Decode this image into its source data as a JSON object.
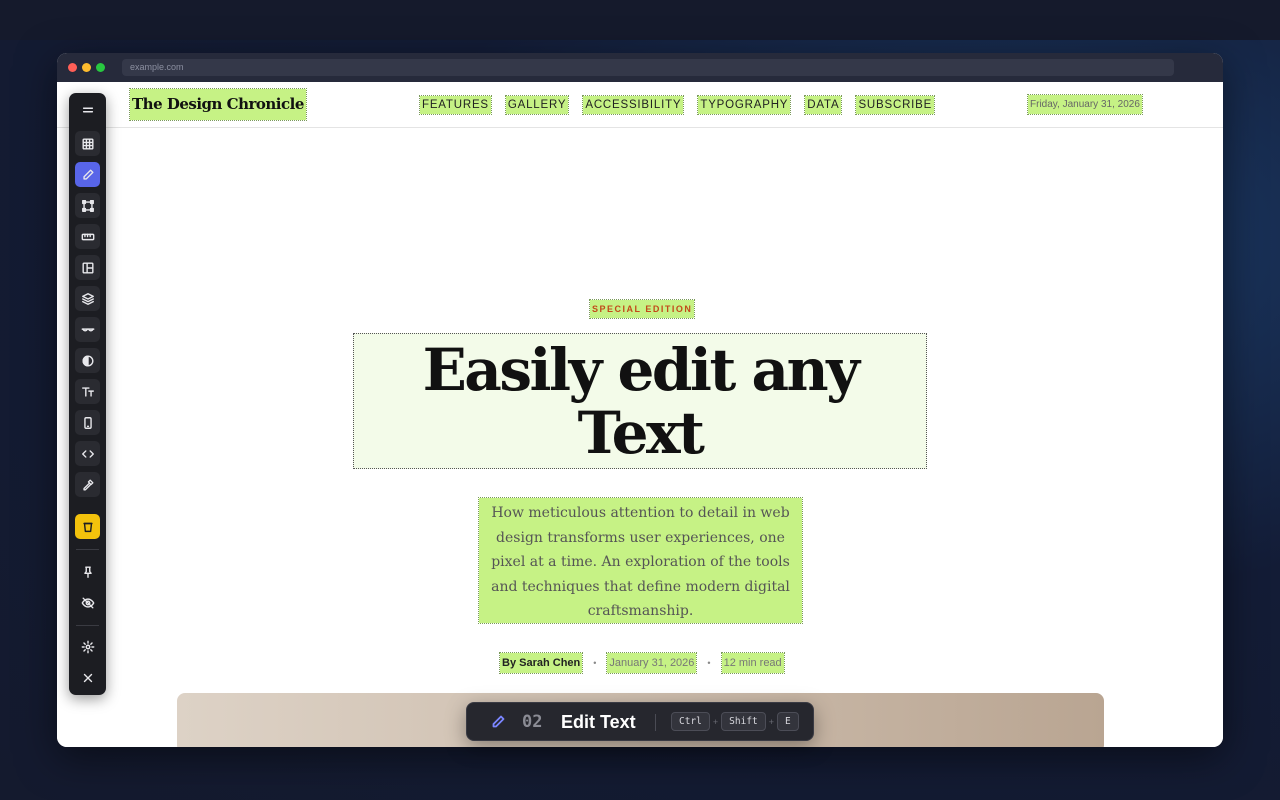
{
  "browser": {
    "url": "example.com"
  },
  "site": {
    "brand": "The Design Chronicle",
    "nav": [
      "FEATURES",
      "GALLERY",
      "ACCESSIBILITY",
      "TYPOGRAPHY",
      "DATA",
      "SUBSCRIBE"
    ],
    "date": "Friday, January 31, 2026"
  },
  "article": {
    "kicker": "SPECIAL EDITION",
    "headline_line1": "Easily edit any",
    "headline_line2": "Text",
    "lede": "How meticulous attention to detail in web design transforms user experiences, one pixel at a time. An exploration of the tools and techniques that define modern digital craftsmanship.",
    "author": "By Sarah Chen",
    "separator": "•",
    "date": "January 31, 2026",
    "read_time": "12 min read"
  },
  "toolbar": {
    "tools": [
      {
        "name": "menu",
        "icon": "menu-icon"
      },
      {
        "name": "grid",
        "icon": "grid-icon"
      },
      {
        "name": "edit-text",
        "icon": "pencil-icon",
        "active": true
      },
      {
        "name": "transform",
        "icon": "bounding-box-icon"
      },
      {
        "name": "ruler",
        "icon": "ruler-icon"
      },
      {
        "name": "layout",
        "icon": "layout-icon"
      },
      {
        "name": "layers",
        "icon": "layers-icon"
      },
      {
        "name": "glasses",
        "icon": "glasses-icon"
      },
      {
        "name": "contrast",
        "icon": "contrast-icon"
      },
      {
        "name": "typography",
        "icon": "text-size-icon"
      },
      {
        "name": "mobile",
        "icon": "mobile-icon"
      },
      {
        "name": "code",
        "icon": "code-icon"
      },
      {
        "name": "color-picker",
        "icon": "eyedropper-icon"
      },
      {
        "name": "coffee",
        "icon": "cup-icon"
      },
      {
        "name": "pin",
        "icon": "pin-icon"
      },
      {
        "name": "hide",
        "icon": "eye-off-icon"
      },
      {
        "name": "settings",
        "icon": "gear-icon"
      },
      {
        "name": "close",
        "icon": "close-icon"
      }
    ],
    "colors": {
      "active": "#5865e8",
      "highlight": "#f3c20c"
    }
  },
  "hud": {
    "number": "02",
    "label": "Edit Text",
    "keys": [
      "Ctrl",
      "Shift",
      "E"
    ],
    "plus": "+"
  },
  "colors": {
    "highlight": "#c6f285",
    "kicker": "#c24a1a"
  }
}
